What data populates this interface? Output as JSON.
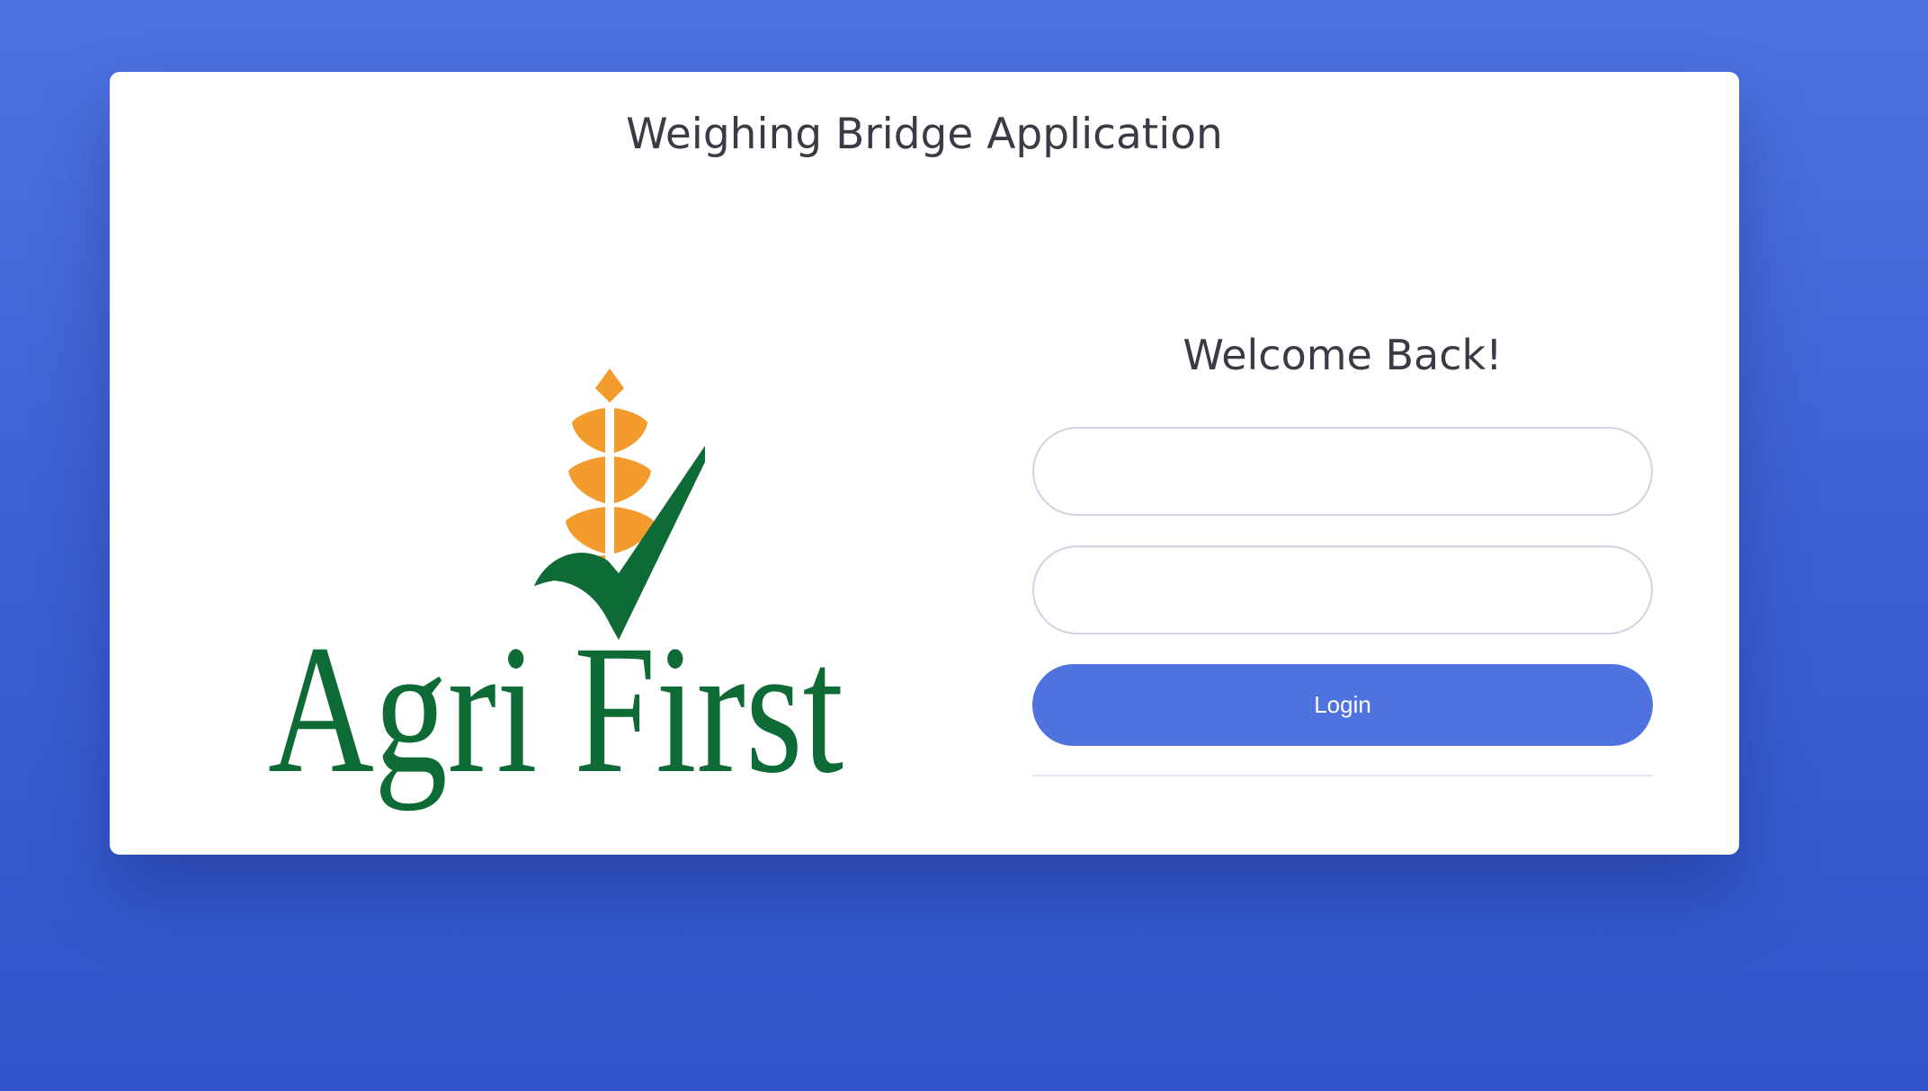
{
  "app": {
    "title": "Weighing Bridge Application"
  },
  "logo": {
    "text": "Agri First",
    "colors": {
      "green": "#0f6b35",
      "orange": "#f39c2d"
    }
  },
  "login": {
    "heading": "Welcome Back!",
    "username": {
      "value": "",
      "placeholder": ""
    },
    "password": {
      "value": "",
      "placeholder": ""
    },
    "submit_label": "Login"
  },
  "theme": {
    "background": "#4e73df",
    "primary_button": "#4e73df"
  }
}
